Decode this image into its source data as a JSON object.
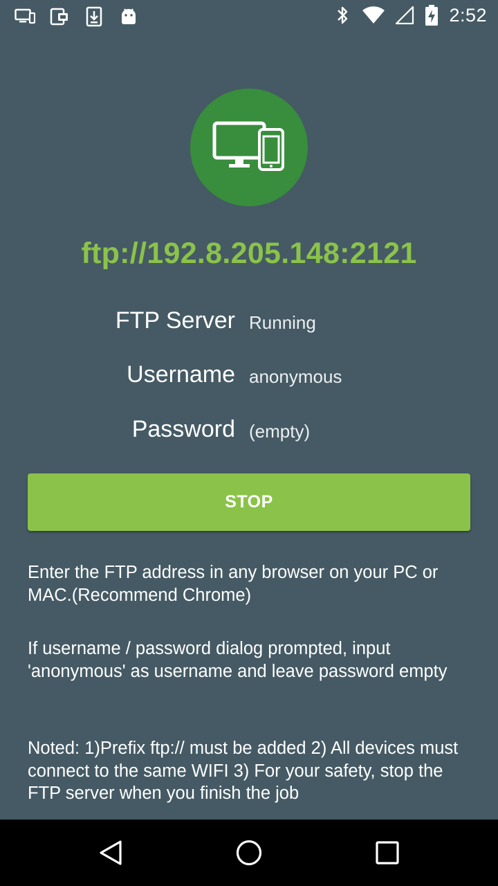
{
  "status_bar": {
    "left_icons": [
      "screen-share-icon",
      "cast-icon",
      "download-icon",
      "android-icon"
    ],
    "right_icons": [
      "bluetooth-icon",
      "wifi-icon",
      "signal-icon",
      "battery-charging-icon"
    ],
    "time": "2:52"
  },
  "hero": {
    "icon": "devices-icon",
    "circle_color": "#388e3c",
    "ftp_address": "ftp://192.8.205.148:2121",
    "address_color": "#8bc34a"
  },
  "info": {
    "server_label": "FTP Server",
    "server_value": "Running",
    "username_label": "Username",
    "username_value": "anonymous",
    "password_label": "Password",
    "password_value": "(empty)"
  },
  "actions": {
    "stop_label": "STOP",
    "button_color": "#8bc34a"
  },
  "instructions": {
    "p1": "Enter the FTP address in any browser on your PC or MAC.(Recommend Chrome)",
    "p2": "If username / password dialog prompted, input 'anonymous' as username and leave password empty",
    "p3": "Noted: 1)Prefix ftp:// must be added 2) All devices must connect to the same WIFI 3) For your safety, stop the FTP server when you finish the job"
  },
  "nav_bar": {
    "back": "back-icon",
    "home": "home-icon",
    "recents": "recents-icon"
  },
  "colors": {
    "background": "#455a64"
  }
}
